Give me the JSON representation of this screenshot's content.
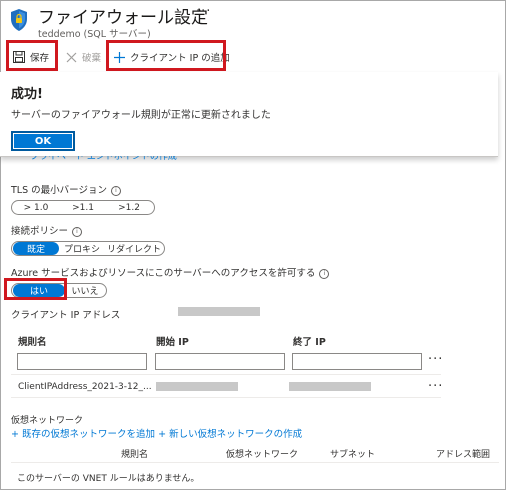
{
  "header": {
    "title": "ファイアウォール設定",
    "more": "···",
    "subtitle": "teddemo (SQL サーバー)"
  },
  "toolbar": {
    "save_label": "保存",
    "discard_label": "破棄",
    "add_client_ip_label": "クライアント IP の追加"
  },
  "notification": {
    "title": "成功!",
    "message": "サーバーのファイアウォール規則が正常に更新されました",
    "ok_label": "OK"
  },
  "private_endpoint_link": "プライベート エンドポイントの作成",
  "tls": {
    "label": "TLS の最小バージョン",
    "options": [
      "> 1.0",
      ">1.1",
      ">1.2"
    ]
  },
  "connection_policy": {
    "label": "接続ポリシー",
    "options": [
      "既定",
      "プロキシ",
      "リダイレクト"
    ],
    "selected": "既定"
  },
  "azure_access": {
    "label": "Azure サービスおよびリソースにこのサーバーへのアクセスを許可する",
    "options": [
      "はい",
      "いいえ"
    ],
    "selected": "はい"
  },
  "client_ip": {
    "label": "クライアント IP アドレス"
  },
  "rules_table": {
    "columns": [
      "規則名",
      "開始 IP",
      "終了 IP"
    ],
    "rows": [
      {
        "name": "ClientIPAddress_2021-3-12_..."
      }
    ],
    "more": "···"
  },
  "vnet": {
    "label": "仮想ネットワーク",
    "add_existing": "+ 既存の仮想ネットワークを追加",
    "create_new": "+ 新しい仮想ネットワークの作成",
    "columns": [
      "規則名",
      "仮想ネットワーク",
      "サブネット",
      "アドレス範囲"
    ],
    "empty_message": "このサーバーの VNET ルールはありません。"
  },
  "colors": {
    "accent": "#0078d4",
    "highlight": "#d0181f"
  }
}
